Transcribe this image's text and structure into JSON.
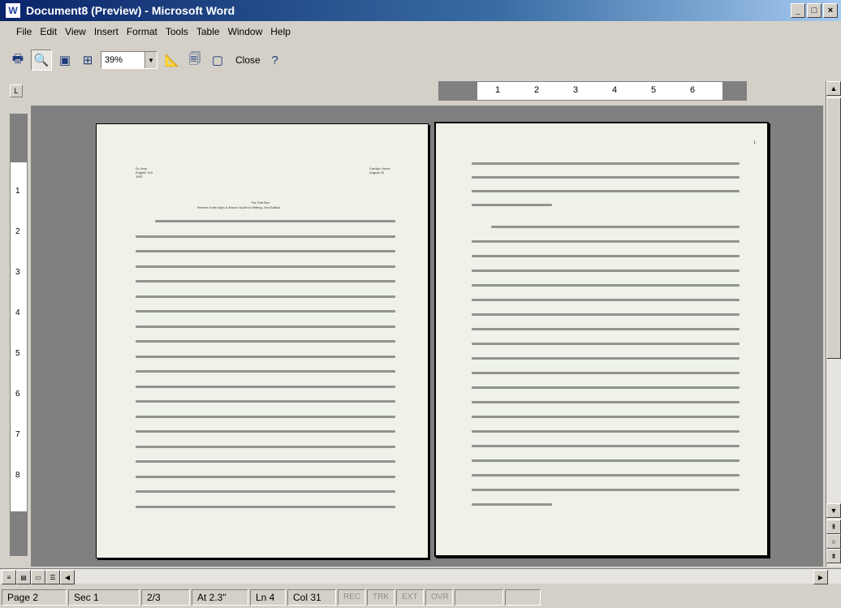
{
  "window": {
    "title": "Document8 (Preview) - Microsoft Word",
    "app_icon": "W",
    "min": "_",
    "max": "□",
    "close": "×"
  },
  "menu": [
    "File",
    "Edit",
    "View",
    "Insert",
    "Format",
    "Tools",
    "Table",
    "Window",
    "Help"
  ],
  "toolbar": {
    "zoom": "39%",
    "close_label": "Close",
    "help_glyph": "?"
  },
  "ruler": {
    "h_numbers": [
      "1",
      "2",
      "3",
      "4",
      "5",
      "6"
    ],
    "v_numbers": [
      "1",
      "2",
      "3",
      "4",
      "5",
      "6",
      "7",
      "8"
    ],
    "corner": "L"
  },
  "document": {
    "left_header": [
      "Dr. Amy",
      "English 104",
      "1997"
    ],
    "right_header": [
      "Carolyn Jones",
      "August 20"
    ],
    "title": "The Soft Box",
    "subtitle": "Review of the Allyn & Bacon Guide to Writing, 2nd Edition",
    "page_number": "1"
  },
  "status": {
    "page": "Page 2",
    "sec": "Sec 1",
    "pages": "2/3",
    "at": "At 2.3\"",
    "ln": "Ln 4",
    "col": "Col 31",
    "rec": "REC",
    "trk": "TRK",
    "ext": "EXT",
    "ovr": "OVR"
  }
}
